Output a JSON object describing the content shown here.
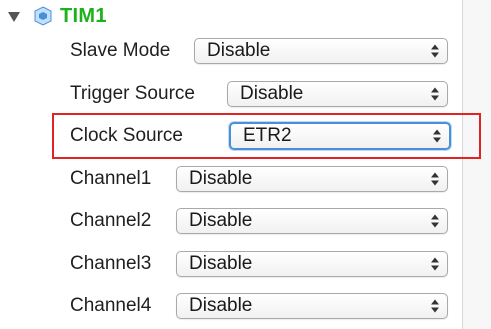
{
  "tree": {
    "node_title": "TIM1",
    "title_color": "#1bb21b"
  },
  "fields": [
    {
      "label": "Slave Mode",
      "value": "Disable"
    },
    {
      "label": "Trigger Source",
      "value": "Disable"
    },
    {
      "label": "Clock Source",
      "value": "ETR2",
      "focused": true
    },
    {
      "label": "Channel1",
      "value": "Disable"
    },
    {
      "label": "Channel2",
      "value": "Disable"
    },
    {
      "label": "Channel3",
      "value": "Disable"
    },
    {
      "label": "Channel4",
      "value": "Disable"
    }
  ],
  "icons": {
    "expand": "disclosure-triangle-down",
    "node": "chip-icon",
    "dropdown": "up-down-stepper"
  },
  "colors": {
    "highlight": "#e02424",
    "focus": "#4a90d9"
  }
}
